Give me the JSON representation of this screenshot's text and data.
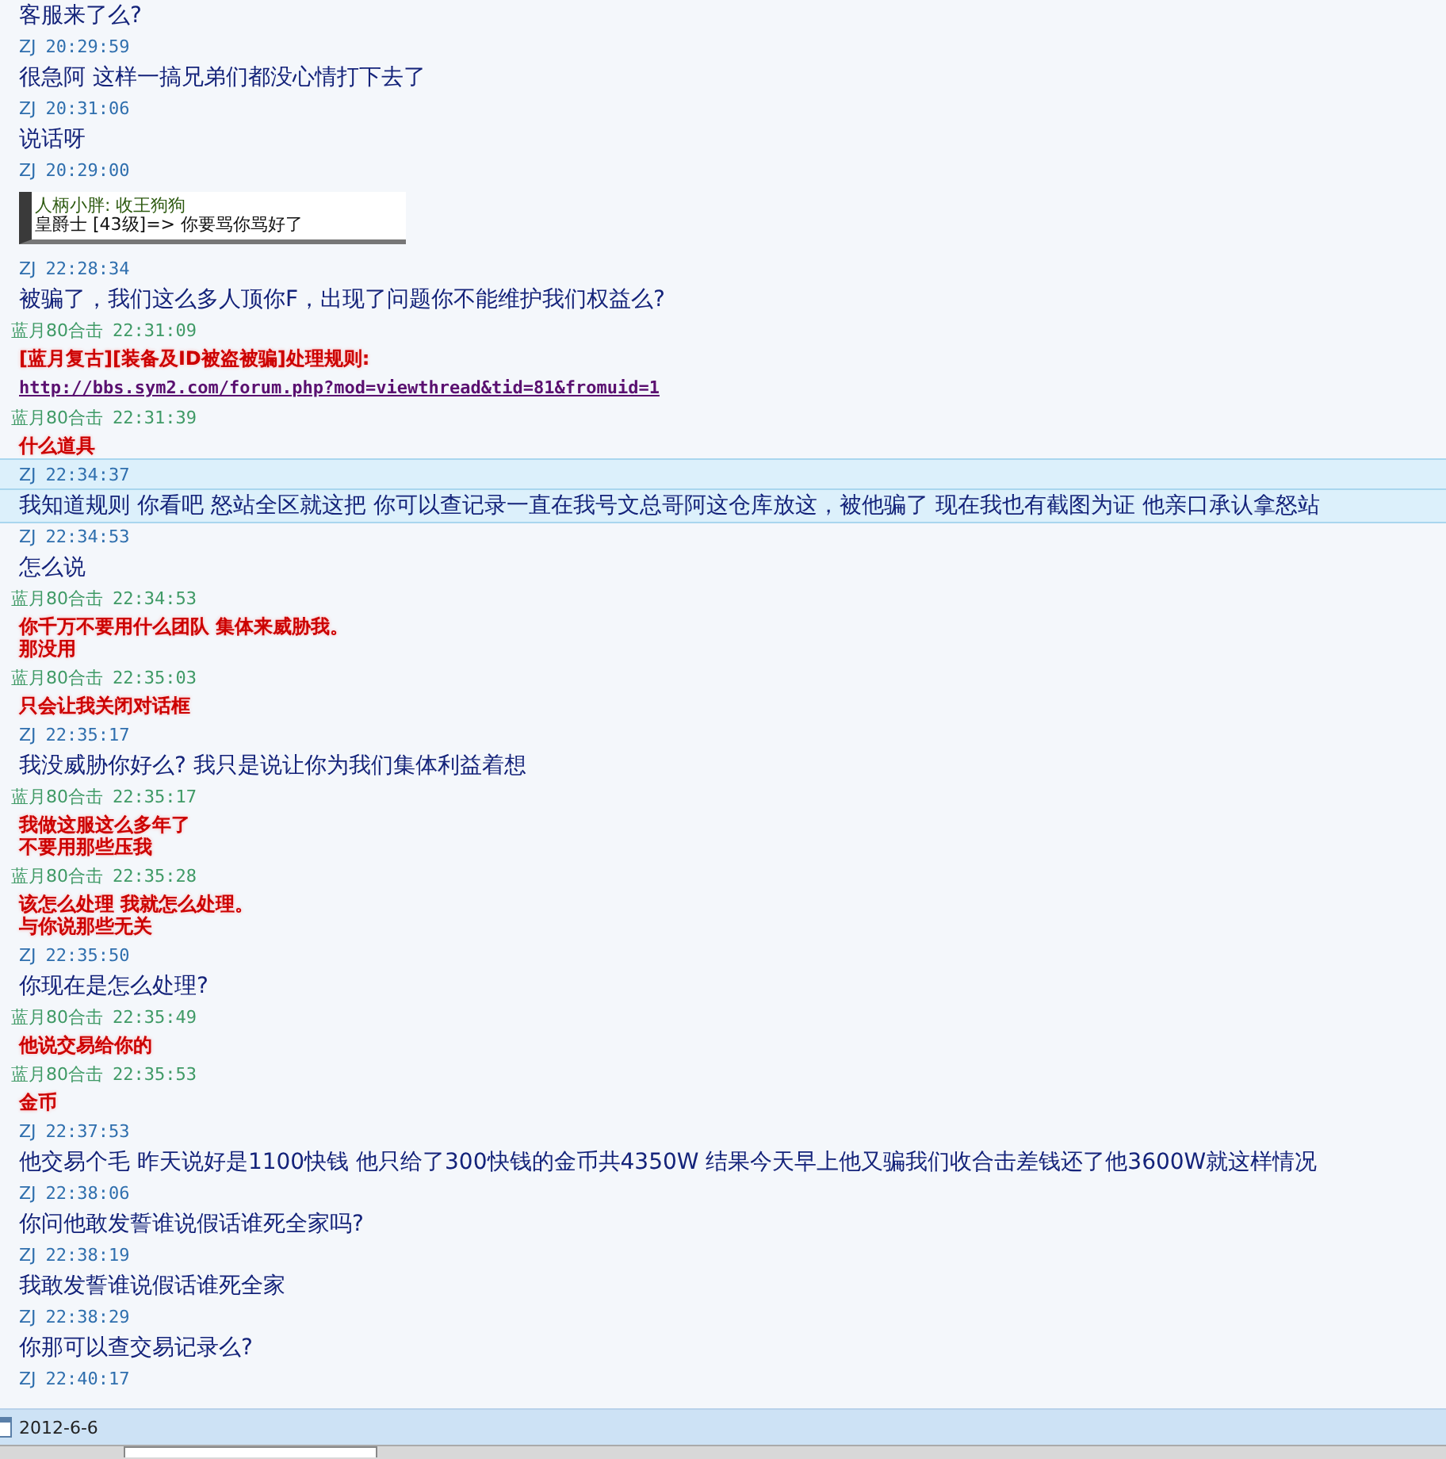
{
  "messages": [
    {
      "kind": "plain",
      "text": "客服来了么?",
      "selected": false
    },
    {
      "kind": "header",
      "sender": "ZJ",
      "time": "20:29:59",
      "color": "#2f6fae",
      "selected": false
    },
    {
      "kind": "plain",
      "text": "很急阿 这样一搞兄弟们都没心情打下去了",
      "selected": false
    },
    {
      "kind": "header",
      "sender": "ZJ",
      "time": "20:31:06",
      "color": "#2f6fae",
      "selected": false
    },
    {
      "kind": "plain",
      "text": "说话呀",
      "selected": false
    },
    {
      "kind": "header",
      "sender": "ZJ",
      "time": "20:29:00",
      "color": "#2f6fae",
      "selected": false
    },
    {
      "kind": "image",
      "lines": [
        "人柄小胖: 收王狗狗",
        "皇爵士 [43级]=> 你要骂你骂好了"
      ],
      "selected": false
    },
    {
      "kind": "header",
      "sender": "ZJ",
      "time": "22:28:34",
      "color": "#2f6fae",
      "selected": false
    },
    {
      "kind": "plain",
      "text": "被骗了，我们这么多人顶你F，出现了问题你不能维护我们权益么?",
      "selected": false
    },
    {
      "kind": "header",
      "sender": "蓝月80合击",
      "time": "22:31:09",
      "color": "#3f9a66",
      "selected": false
    },
    {
      "kind": "rule",
      "title": "[蓝月复古][装备及ID被盗被骗]处理规则:",
      "link": "http://bbs.sym2.com/forum.php?mod=viewthread&tid=81&fromuid=1",
      "selected": false
    },
    {
      "kind": "header",
      "sender": "蓝月80合击",
      "time": "22:31:39",
      "color": "#3f9a66",
      "selected": false
    },
    {
      "kind": "notice",
      "lines": [
        "什么道具"
      ],
      "selected": false
    },
    {
      "kind": "header",
      "sender": "ZJ",
      "time": "22:34:37",
      "color": "#2f6fae",
      "selected": true
    },
    {
      "kind": "plain",
      "text": "我知道规则 你看吧 怒站全区就这把 你可以查记录一直在我号文总哥阿这仓库放这，被他骗了 现在我也有截图为证 他亲口承认拿怒站",
      "selected": true
    },
    {
      "kind": "header",
      "sender": "ZJ",
      "time": "22:34:53",
      "color": "#2f6fae",
      "selected": false
    },
    {
      "kind": "plain",
      "text": "怎么说",
      "selected": false
    },
    {
      "kind": "header",
      "sender": "蓝月80合击",
      "time": "22:34:53",
      "color": "#3f9a66",
      "selected": false
    },
    {
      "kind": "notice",
      "lines": [
        "你千万不要用什么团队 集体来威胁我。",
        "那没用"
      ],
      "selected": false
    },
    {
      "kind": "header",
      "sender": "蓝月80合击",
      "time": "22:35:03",
      "color": "#3f9a66",
      "selected": false
    },
    {
      "kind": "notice",
      "lines": [
        "只会让我关闭对话框"
      ],
      "selected": false
    },
    {
      "kind": "header",
      "sender": "ZJ",
      "time": "22:35:17",
      "color": "#2f6fae",
      "selected": false
    },
    {
      "kind": "plain",
      "text": "我没威胁你好么? 我只是说让你为我们集体利益着想",
      "selected": false
    },
    {
      "kind": "header",
      "sender": "蓝月80合击",
      "time": "22:35:17",
      "color": "#3f9a66",
      "selected": false
    },
    {
      "kind": "notice",
      "lines": [
        "我做这服这么多年了",
        "不要用那些压我"
      ],
      "selected": false
    },
    {
      "kind": "header",
      "sender": "蓝月80合击",
      "time": "22:35:28",
      "color": "#3f9a66",
      "selected": false
    },
    {
      "kind": "notice",
      "lines": [
        "该怎么处理 我就怎么处理。",
        "与你说那些无关"
      ],
      "selected": false
    },
    {
      "kind": "header",
      "sender": "ZJ",
      "time": "22:35:50",
      "color": "#2f6fae",
      "selected": false
    },
    {
      "kind": "plain",
      "text": "你现在是怎么处理?",
      "selected": false
    },
    {
      "kind": "header",
      "sender": "蓝月80合击",
      "time": "22:35:49",
      "color": "#3f9a66",
      "selected": false
    },
    {
      "kind": "notice",
      "lines": [
        "他说交易给你的"
      ],
      "selected": false
    },
    {
      "kind": "header",
      "sender": "蓝月80合击",
      "time": "22:35:53",
      "color": "#3f9a66",
      "selected": false
    },
    {
      "kind": "notice",
      "lines": [
        "金币"
      ],
      "selected": false
    },
    {
      "kind": "header",
      "sender": "ZJ",
      "time": "22:37:53",
      "color": "#2f6fae",
      "selected": false
    },
    {
      "kind": "plain",
      "text": "他交易个毛 昨天说好是1100快钱 他只给了300快钱的金币共4350W 结果今天早上他又骗我们收合击差钱还了他3600W就这样情况",
      "selected": false
    },
    {
      "kind": "header",
      "sender": "ZJ",
      "time": "22:38:06",
      "color": "#2f6fae",
      "selected": false
    },
    {
      "kind": "plain",
      "text": "你问他敢发誓谁说假话谁死全家吗?",
      "selected": false
    },
    {
      "kind": "header",
      "sender": "ZJ",
      "time": "22:38:19",
      "color": "#2f6fae",
      "selected": false
    },
    {
      "kind": "plain",
      "text": "我敢发誓谁说假话谁死全家",
      "selected": false
    },
    {
      "kind": "header",
      "sender": "ZJ",
      "time": "22:38:29",
      "color": "#2f6fae",
      "selected": false
    },
    {
      "kind": "plain",
      "text": "你那可以查交易记录么?",
      "selected": false
    },
    {
      "kind": "header",
      "sender": "ZJ",
      "time": "22:40:17",
      "color": "#2f6fae",
      "selected": false
    }
  ],
  "date_bar": {
    "date": "2012-6-6"
  }
}
